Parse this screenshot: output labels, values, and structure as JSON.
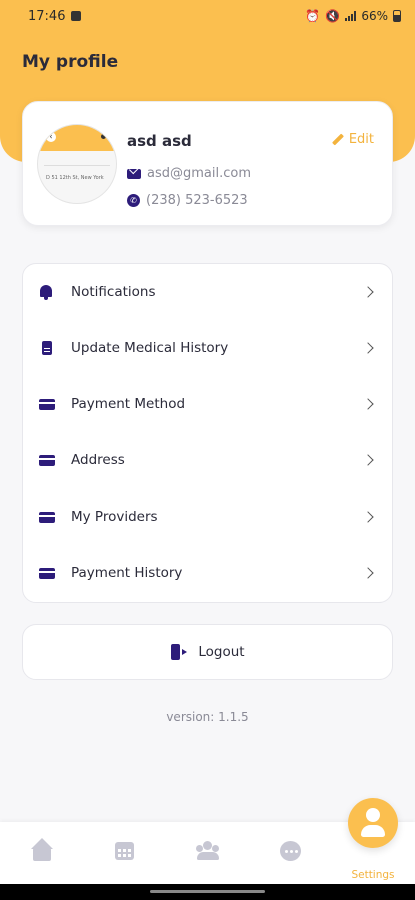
{
  "status_bar": {
    "time": "17:46",
    "battery": "66%"
  },
  "header": {
    "title": "My profile"
  },
  "profile": {
    "name": "asd asd",
    "email": "asd@gmail.com",
    "phone": "(238) 523-6523",
    "edit_label": "Edit",
    "avatar_caption": "D 51 12th St, New York"
  },
  "menu": {
    "items": [
      {
        "label": "Notifications",
        "icon": "bell-icon"
      },
      {
        "label": "Update Medical History",
        "icon": "document-icon"
      },
      {
        "label": "Payment Method",
        "icon": "card-icon"
      },
      {
        "label": "Address",
        "icon": "card-icon"
      },
      {
        "label": "My Providers",
        "icon": "card-icon"
      },
      {
        "label": "Payment History",
        "icon": "card-icon"
      }
    ]
  },
  "logout": {
    "label": "Logout"
  },
  "version": "version: 1.1.5",
  "bottom_nav": {
    "settings_label": "Settings"
  },
  "colors": {
    "accent": "#fbbf4f",
    "icon": "#2d1c7a",
    "muted": "#c7c7d3"
  }
}
